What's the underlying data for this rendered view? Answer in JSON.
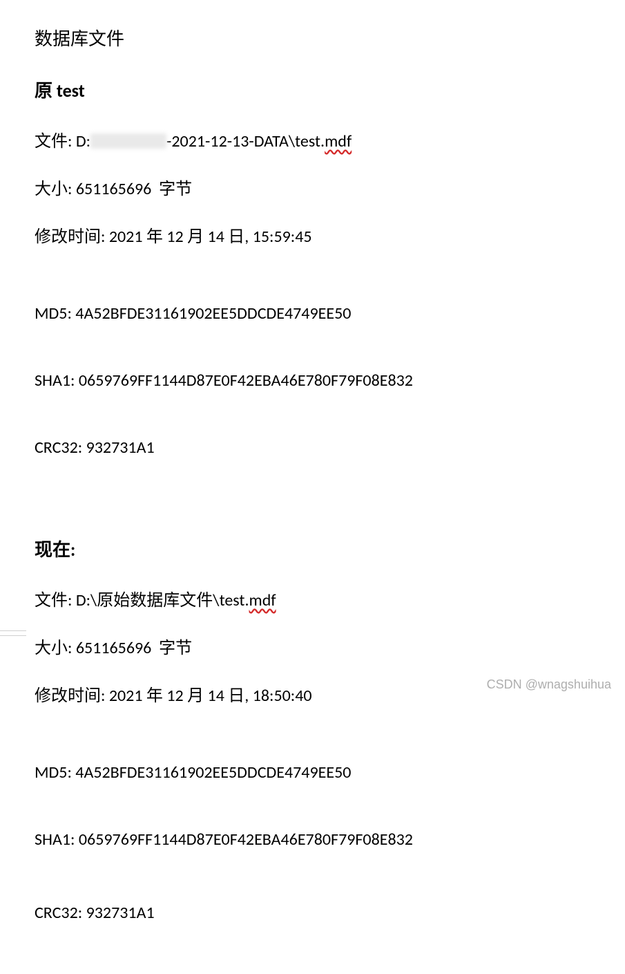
{
  "title": "数据库文件",
  "sections": {
    "original": {
      "heading": "原 test",
      "file_label": "文件: D:",
      "file_suffix_a": "-2021-12-13-DATA\\test.",
      "file_suffix_b": "mdf",
      "size": "大小: 651165696  字节",
      "mtime": "修改时间: 2021 年 12 月 14 日, 15:59:45",
      "md5": "MD5: 4A52BFDE31161902EE5DDCDE4749EE50",
      "sha1": "SHA1: 0659769FF1144D87E0F42EBA46E780F79F08E832",
      "crc32": "CRC32: 932731A1"
    },
    "current": {
      "heading": "现在:",
      "file_a": "文件: D:\\原始数据库文件\\test.",
      "file_b": "mdf",
      "size": "大小: 651165696  字节",
      "mtime": "修改时间: 2021 年 12 月 14 日, 18:50:40",
      "md5": "MD5: 4A52BFDE31161902EE5DDCDE4749EE50",
      "sha1": "SHA1: 0659769FF1144D87E0F42EBA46E780F79F08E832",
      "crc32": "CRC32: 932731A1"
    }
  },
  "watermark": "CSDN @wnagshuihua"
}
